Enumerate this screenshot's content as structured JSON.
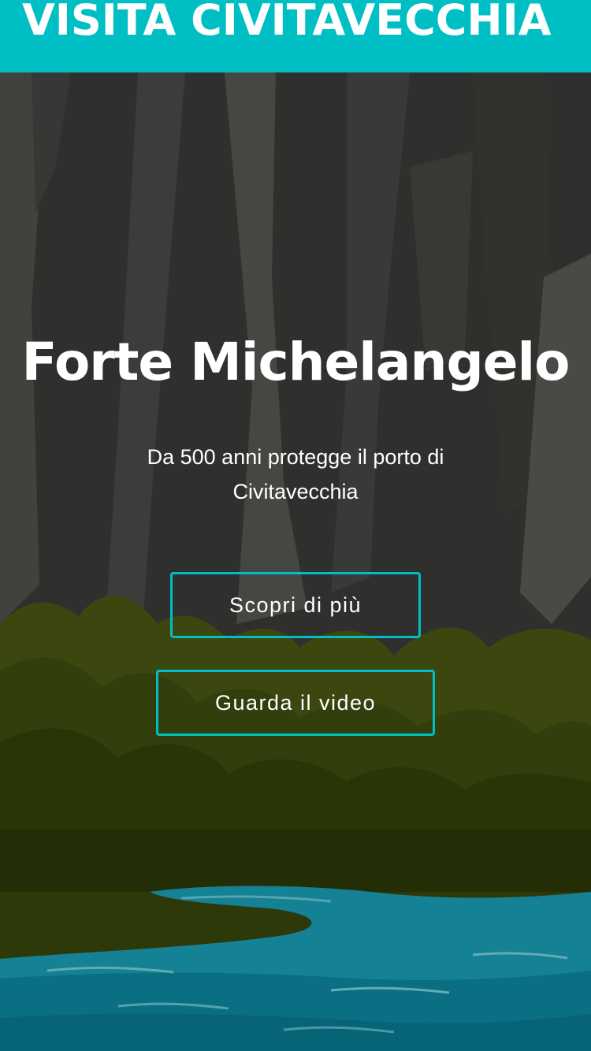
{
  "header": {
    "site_title": "VISITA CIVITAVECCHIA"
  },
  "hero": {
    "title": "Forte Michelangelo",
    "subtitle": "Da 500 anni protegge il porto di Civitavecchia",
    "buttons": {
      "discover_label": "Scopri di più",
      "video_label": "Guarda il video"
    },
    "background": "forest-river-illustration"
  },
  "colors": {
    "accent": "#00bfc4",
    "text": "#ffffff",
    "dark_background": "#3a3b38",
    "foliage": "#3a4a0e",
    "water": "#0e95ad"
  }
}
